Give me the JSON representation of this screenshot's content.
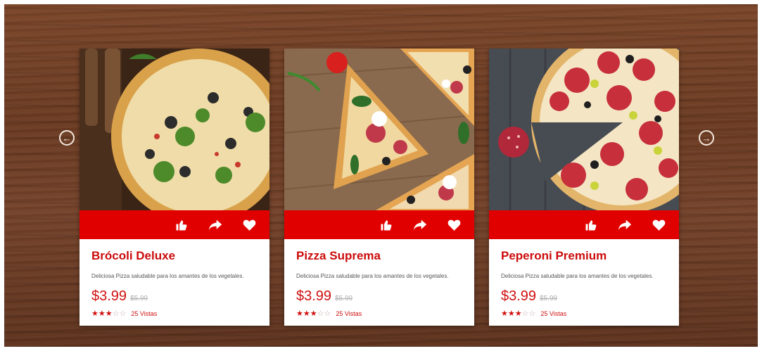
{
  "carousel": {
    "prev_label": "←",
    "next_label": "→"
  },
  "products": [
    {
      "name": "Brócoli Deluxe",
      "description": "Deliciosa Pizza saludable para los amantes de los vegetales.",
      "price": "$3.99",
      "old_price": "$5.99",
      "rating": 3,
      "max_rating": 5,
      "views": "25 Vistas"
    },
    {
      "name": "Pizza Suprema",
      "description": "Deliciosa Pizza saludable para los amantes de los vegetales.",
      "price": "$3.99",
      "old_price": "$5.99",
      "rating": 3,
      "max_rating": 5,
      "views": "25 Vistas"
    },
    {
      "name": "Peperoni Premium",
      "description": "Deliciosa Pizza saludable para los amantes de los vegetales.",
      "price": "$3.99",
      "old_price": "$5.99",
      "rating": 3,
      "max_rating": 5,
      "views": "25 Vistas"
    }
  ],
  "actions": [
    "thumbs-up-icon",
    "share-arrow-icon",
    "heart-icon"
  ],
  "colors": {
    "accent": "#e10000",
    "title": "#cc0b0b",
    "wood": "#6b3b22"
  }
}
